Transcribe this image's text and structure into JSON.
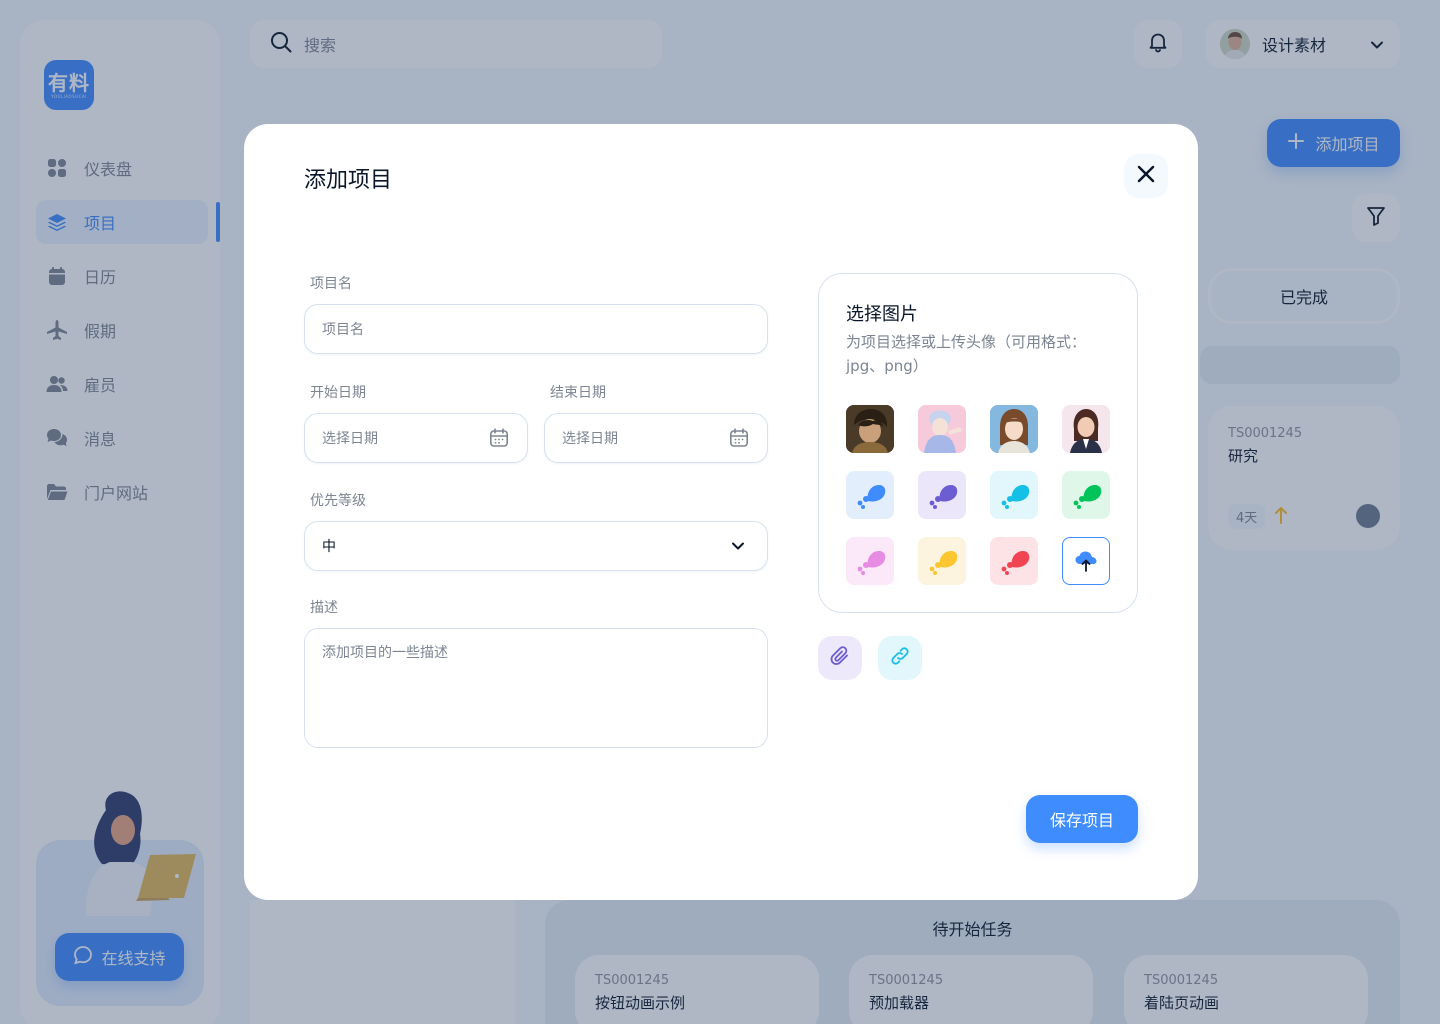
{
  "app": {
    "logo_main": "有料",
    "logo_sub": "YOULIAOSUCAI"
  },
  "sidebar": {
    "items": [
      {
        "label": "仪表盘",
        "icon": "dashboard-icon"
      },
      {
        "label": "项目",
        "icon": "layers-icon"
      },
      {
        "label": "日历",
        "icon": "calendar-icon"
      },
      {
        "label": "假期",
        "icon": "airplane-icon"
      },
      {
        "label": "雇员",
        "icon": "users-icon"
      },
      {
        "label": "消息",
        "icon": "chat-icon"
      },
      {
        "label": "门户网站",
        "icon": "folder-icon"
      }
    ],
    "active_index": 1,
    "support_label": "在线支持"
  },
  "header": {
    "search_placeholder": "搜索",
    "profile_name": "设计素材"
  },
  "page": {
    "add_project_label": "添加项目",
    "done_label": "已完成",
    "side_task": {
      "id": "TS0001245",
      "name": "研究",
      "days": "4天"
    },
    "todo_title": "待开始任务",
    "todo_tasks": [
      {
        "id": "TS0001245",
        "name": "按钮动画示例"
      },
      {
        "id": "TS0001245",
        "name": "预加载器"
      },
      {
        "id": "TS0001245",
        "name": "着陆页动画"
      }
    ]
  },
  "modal": {
    "title": "添加项目",
    "name_label": "项目名",
    "name_placeholder": "项目名",
    "start_label": "开始日期",
    "end_label": "结束日期",
    "date_placeholder": "选择日期",
    "priority_label": "优先等级",
    "priority_value": "中",
    "desc_label": "描述",
    "desc_placeholder": "添加项目的一些描述",
    "image_title": "选择图片",
    "image_subtitle": "为项目选择或上传头像（可用格式：jpg、png）",
    "save_label": "保存项目",
    "avatar_colors": [
      "#3f8cff",
      "#6d5dd3",
      "#15c0e6",
      "#00d97e",
      "#f65de5",
      "#fbc62f",
      "#ff4f5a"
    ]
  },
  "colors": {
    "accent": "#3f8cff",
    "text": "#0a1629",
    "muted": "#7d8592",
    "background": "#f4f9fd"
  }
}
